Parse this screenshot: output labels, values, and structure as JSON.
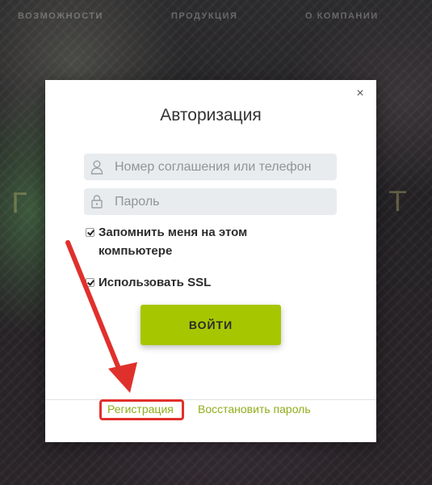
{
  "background": {
    "nav_items": [
      "возможности",
      "продукция",
      "о компании"
    ],
    "letters": [
      "Г",
      "Т"
    ]
  },
  "modal": {
    "close": "×",
    "title": "Авторизация",
    "login": {
      "placeholder": "Номер соглашения или телефон",
      "value": "",
      "icon": "user-icon"
    },
    "password": {
      "placeholder": "Пароль",
      "value": "",
      "icon": "lock-icon"
    },
    "remember": {
      "label": "Запомнить меня на этом компьютере",
      "checked": true
    },
    "ssl": {
      "label": "Использовать SSL",
      "checked": true
    },
    "submit_label": "ВОЙТИ",
    "register_link": "Регистрация",
    "restore_link": "Восстановить пароль"
  },
  "annotation": {
    "color": "#e0302c",
    "target": "Регистрация"
  },
  "colors": {
    "accent": "#a6c700",
    "link": "#8fae1b",
    "field_bg": "#e8ecef"
  }
}
